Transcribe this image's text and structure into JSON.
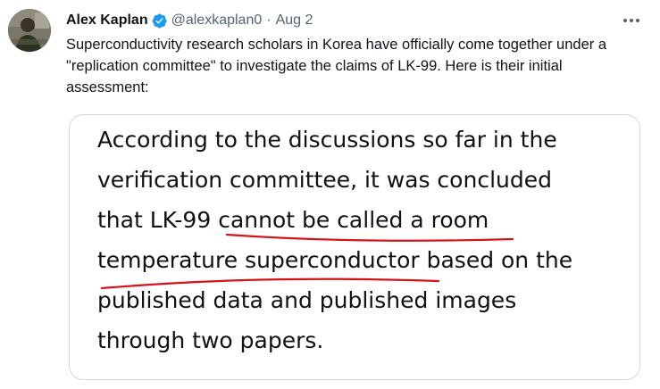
{
  "author": {
    "display_name": "Alex Kaplan",
    "handle": "@alexkaplan0",
    "separator": "·",
    "date": "Aug 2",
    "verified_color": "#1d9bf0"
  },
  "tweet": {
    "text": "Superconductivity research scholars in Korea have officially come together under a \"replication committee\" to investigate the claims of LK-99. Here is their initial assessment:"
  },
  "media": {
    "lines": [
      "According to the discussions so far in the",
      "verification committee, it was concluded",
      "that LK-99 cannot be called a room",
      "temperature superconductor based on the",
      "published data and published images",
      "through two papers."
    ],
    "underline_color": "#d4141a"
  },
  "icons": {
    "verified": "verified-badge-icon",
    "more": "more-options-icon"
  }
}
